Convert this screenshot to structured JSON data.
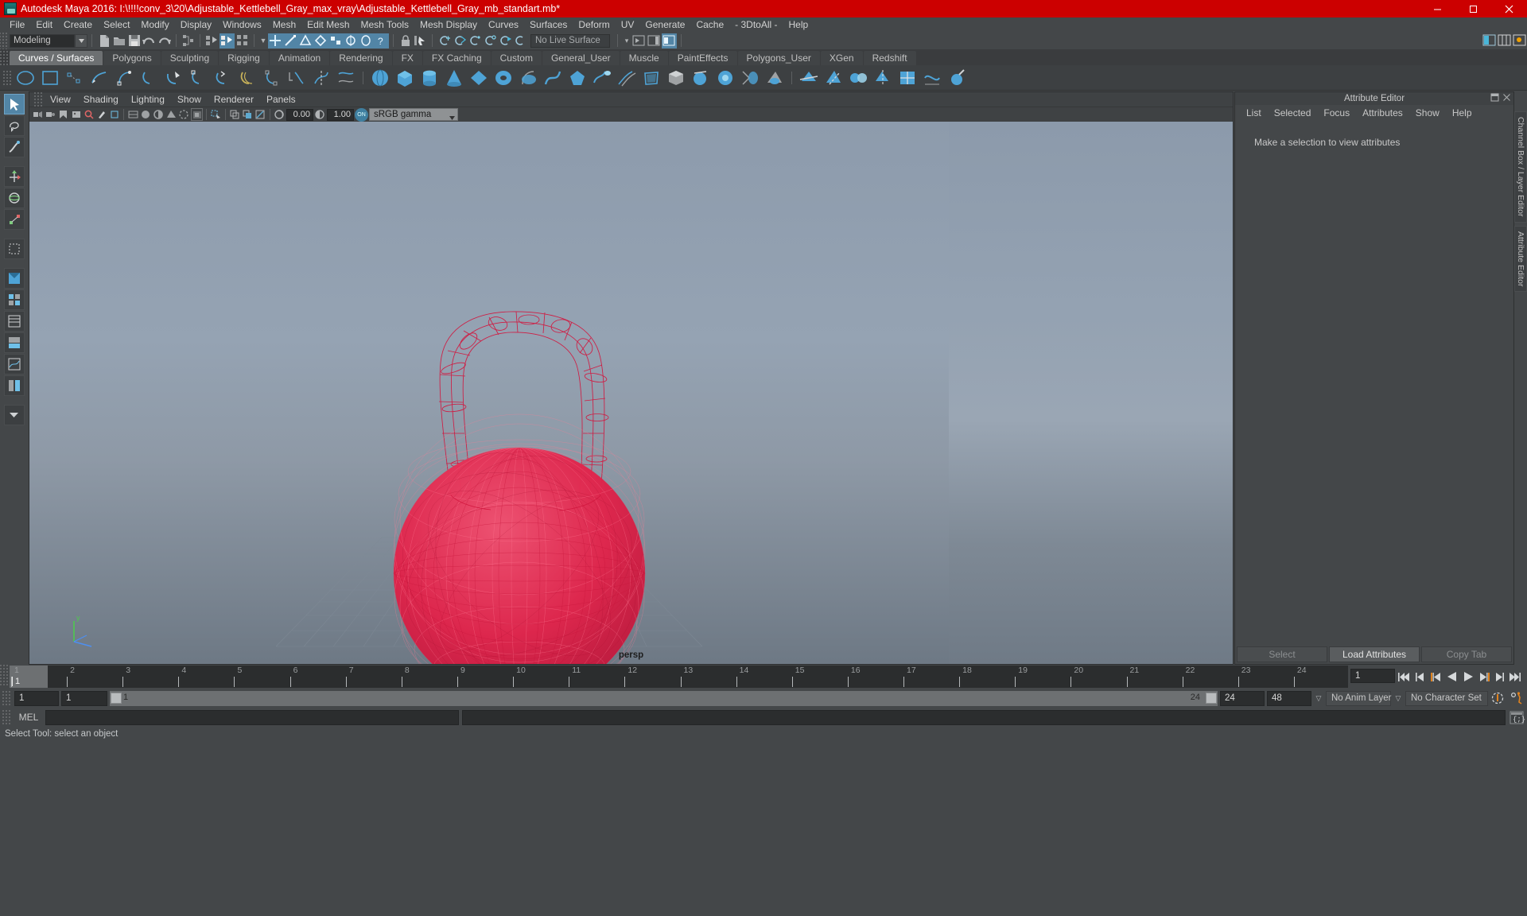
{
  "window": {
    "title": "Autodesk Maya 2016: I:\\!!!!conv_3\\20\\Adjustable_Kettlebell_Gray_max_vray\\Adjustable_Kettlebell_Gray_mb_standart.mb*",
    "minimize": "—",
    "maximize": "❐",
    "close": "✕",
    "title_bar_color": "#cc0000"
  },
  "menubar": {
    "items": [
      {
        "label": "File"
      },
      {
        "label": "Edit"
      },
      {
        "label": "Create"
      },
      {
        "label": "Select"
      },
      {
        "label": "Modify"
      },
      {
        "label": "Display"
      },
      {
        "label": "Windows"
      },
      {
        "label": "Mesh"
      },
      {
        "label": "Edit Mesh"
      },
      {
        "label": "Mesh Tools"
      },
      {
        "label": "Mesh Display"
      },
      {
        "label": "Curves"
      },
      {
        "label": "Surfaces"
      },
      {
        "label": "Deform"
      },
      {
        "label": "UV"
      },
      {
        "label": "Generate"
      },
      {
        "label": "Cache"
      },
      {
        "label": "- 3DtoAll -"
      },
      {
        "label": "Help"
      }
    ]
  },
  "statusline": {
    "mode": "Modeling",
    "no_live_surface": "No Live Surface"
  },
  "shelf": {
    "tabs": [
      {
        "label": "Curves / Surfaces",
        "active": true
      },
      {
        "label": "Polygons",
        "active": false
      },
      {
        "label": "Sculpting",
        "active": false
      },
      {
        "label": "Rigging",
        "active": false
      },
      {
        "label": "Animation",
        "active": false
      },
      {
        "label": "Rendering",
        "active": false
      },
      {
        "label": "FX",
        "active": false
      },
      {
        "label": "FX Caching",
        "active": false
      },
      {
        "label": "Custom",
        "active": false
      },
      {
        "label": "General_User",
        "active": false
      },
      {
        "label": "Muscle",
        "active": false
      },
      {
        "label": "PaintEffects",
        "active": false
      },
      {
        "label": "Polygons_User",
        "active": false
      },
      {
        "label": "XGen",
        "active": false
      },
      {
        "label": "Redshift",
        "active": false
      }
    ]
  },
  "viewport": {
    "panel_menu": [
      "View",
      "Shading",
      "Lighting",
      "Show",
      "Renderer",
      "Panels"
    ],
    "exposure": "0.00",
    "gamma": "1.00",
    "color_profile": "sRGB gamma",
    "toggle_on_label": "ON",
    "camera_label": "persp",
    "axis_label": "y",
    "object_wire_color": "#e0244b",
    "bg_top_color": "#8c9aab",
    "bg_bottom_color": "#6f7a86"
  },
  "attribute_editor": {
    "title": "Attribute Editor",
    "menu": [
      "List",
      "Selected",
      "Focus",
      "Attributes",
      "Show",
      "Help"
    ],
    "empty_message": "Make a selection to view attributes",
    "buttons": [
      {
        "label": "Select",
        "primary": false
      },
      {
        "label": "Load Attributes",
        "primary": true
      },
      {
        "label": "Copy Tab",
        "primary": false
      }
    ]
  },
  "right_tabs": [
    {
      "label": "Channel Box / Layer Editor"
    },
    {
      "label": "Attribute Editor"
    }
  ],
  "timeslider": {
    "ticks": [
      "1",
      "2",
      "3",
      "4",
      "5",
      "6",
      "7",
      "8",
      "9",
      "10",
      "11",
      "12",
      "13",
      "14",
      "15",
      "16",
      "17",
      "18",
      "19",
      "20",
      "21",
      "22",
      "23",
      "24"
    ],
    "current_frame_marker": "1",
    "current_frame_field": "1",
    "playback_buttons": [
      {
        "name": "go-to-start-icon"
      },
      {
        "name": "step-back-frame-icon"
      },
      {
        "name": "step-back-key-icon"
      },
      {
        "name": "play-backwards-icon"
      },
      {
        "name": "play-forwards-icon"
      },
      {
        "name": "step-forward-key-icon"
      },
      {
        "name": "step-forward-frame-icon"
      },
      {
        "name": "go-to-end-icon"
      }
    ]
  },
  "rangerow": {
    "anim_start": "1",
    "range_start": "1",
    "range_bar_start": "1",
    "range_bar_end": "24",
    "range_end": "24",
    "anim_end": "48",
    "anim_layer": "No Anim Layer",
    "character_set": "No Character Set"
  },
  "command_line": {
    "label": "MEL",
    "input_value": "",
    "output_value": ""
  },
  "helpline": {
    "text": "Select Tool: select an object"
  }
}
